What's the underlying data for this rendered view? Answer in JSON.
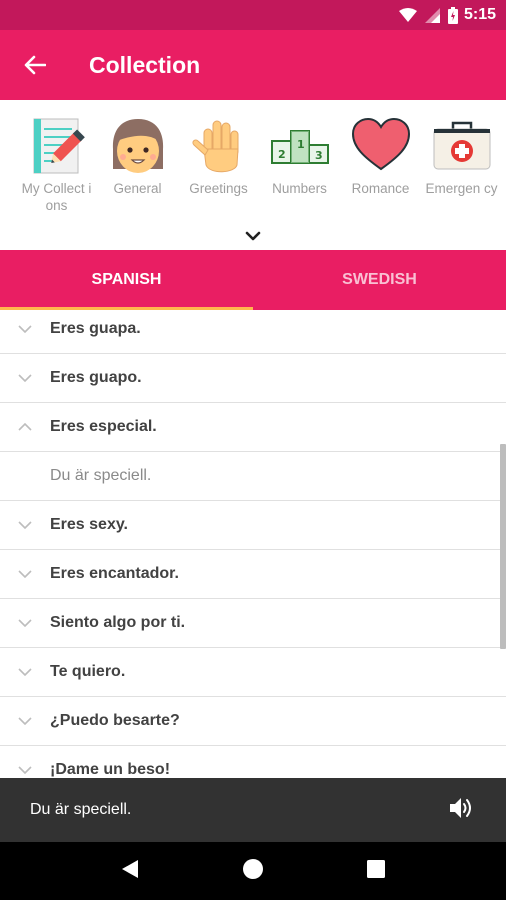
{
  "status_bar": {
    "time": "5:15"
  },
  "app_bar": {
    "title": "Collection"
  },
  "categories": [
    {
      "label": "My Collect ions",
      "icon": "notepad-pencil-icon"
    },
    {
      "label": "General",
      "icon": "girl-face-icon"
    },
    {
      "label": "Greetings",
      "icon": "waving-hand-icon"
    },
    {
      "label": "Numbers",
      "icon": "podium-icon"
    },
    {
      "label": "Romance",
      "icon": "heart-icon"
    },
    {
      "label": "Emergen cy",
      "icon": "first-aid-kit-icon"
    }
  ],
  "tabs": {
    "spanish": "SPANISH",
    "swedish": "SWEDISH",
    "active": "SPANISH"
  },
  "phrases": [
    {
      "text": "Eres guapa.",
      "expanded": false
    },
    {
      "text": "Eres guapo.",
      "expanded": false
    },
    {
      "text": "Eres especial.",
      "expanded": true
    },
    {
      "text": "Du är speciell.",
      "answer": true
    },
    {
      "text": "Eres sexy.",
      "expanded": false
    },
    {
      "text": "Eres encantador.",
      "expanded": false
    },
    {
      "text": "Siento algo por ti.",
      "expanded": false
    },
    {
      "text": "Te quiero.",
      "expanded": false
    },
    {
      "text": "¿Puedo besarte?",
      "expanded": false
    },
    {
      "text": "¡Dame un beso!",
      "expanded": false
    }
  ],
  "player": {
    "text": "Du är speciell.",
    "icon": "speaker-icon"
  },
  "colors": {
    "primary": "#e91e63",
    "primary_dark": "#c2185b",
    "tab_indicator": "#ffb74d",
    "snackbar": "#323232"
  }
}
